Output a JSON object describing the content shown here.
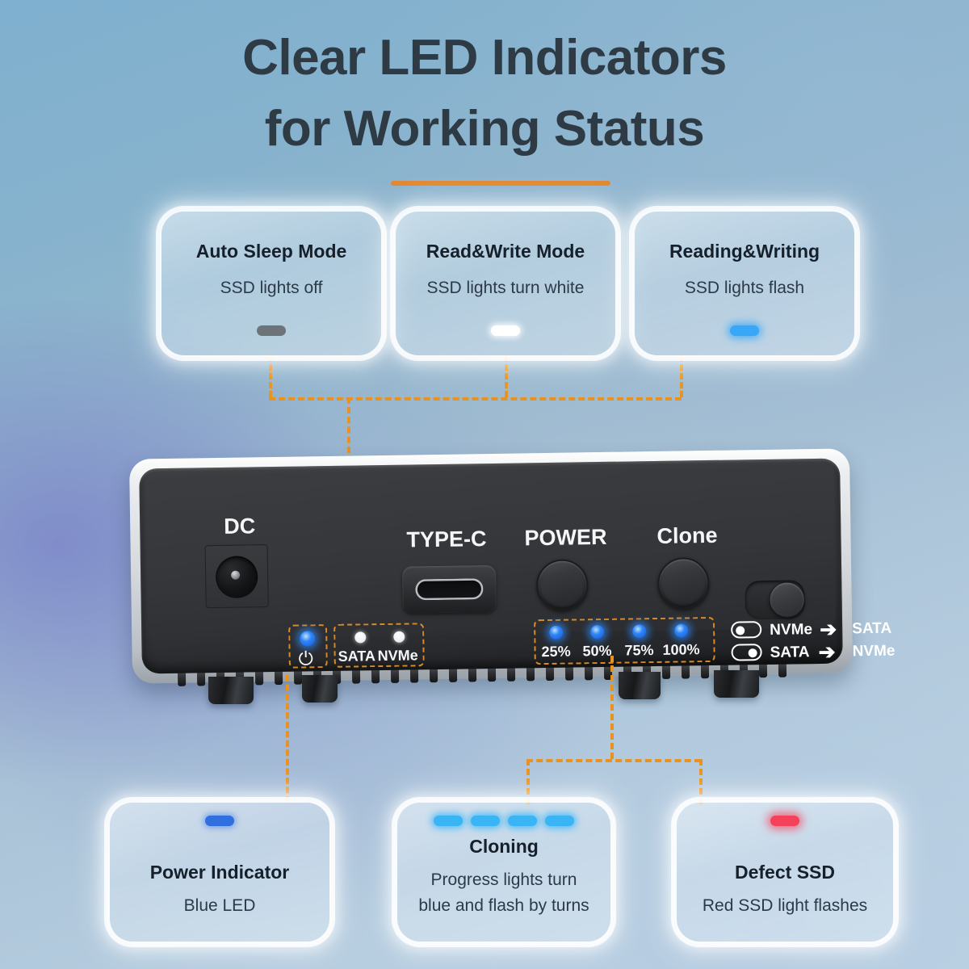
{
  "title": {
    "line1": "Clear LED Indicators",
    "line2": "for Working Status",
    "accent_color": "#e3862e"
  },
  "cards_top": [
    {
      "title": "Auto Sleep Mode",
      "subtitle": "SSD lights off",
      "led_state": "off",
      "led_count": 1
    },
    {
      "title": "Read&Write Mode",
      "subtitle": "SSD lights turn white",
      "led_state": "white",
      "led_count": 1
    },
    {
      "title": "Reading&Writing",
      "subtitle": "SSD lights flash",
      "led_state": "blue",
      "led_count": 1
    }
  ],
  "cards_bottom": [
    {
      "title": "Power Indicator",
      "subtitle": "Blue LED",
      "subtitle2": "",
      "led_state": "deepblue",
      "led_count": 1
    },
    {
      "title": "Cloning",
      "subtitle": "Progress lights turn",
      "subtitle2": "blue and flash by turns",
      "led_state": "cyan",
      "led_count": 4
    },
    {
      "title": "Defect SSD",
      "subtitle": "Red SSD light flashes",
      "subtitle2": "",
      "led_state": "red",
      "led_count": 1
    }
  ],
  "device": {
    "port_labels": {
      "dc": "DC",
      "typec": "TYPE-C",
      "power": "POWER",
      "clone": "Clone"
    },
    "status_leds": {
      "power_symbol": "⏻",
      "sata_label": "SATA",
      "nvme_label": "NVMe"
    },
    "progress_leds": [
      {
        "label": "25%",
        "state": "blue"
      },
      {
        "label": "50%",
        "state": "blue"
      },
      {
        "label": "75%",
        "state": "blue"
      },
      {
        "label": "100%",
        "state": "blue"
      }
    ],
    "clone_modes": [
      {
        "knob": "left",
        "from": "NVMe",
        "arrow": "➔",
        "to": "SATA"
      },
      {
        "knob": "right",
        "from": "SATA",
        "arrow": "➔",
        "to": "NVMe"
      }
    ]
  },
  "colors": {
    "connector_line": "#e8931f",
    "panel_black": "#333538",
    "shell_silver": "#d4d8dc",
    "led_blue": "#2f86f7",
    "led_white": "#ffffff",
    "led_red": "#f5415a",
    "led_off": "#6d7479"
  }
}
